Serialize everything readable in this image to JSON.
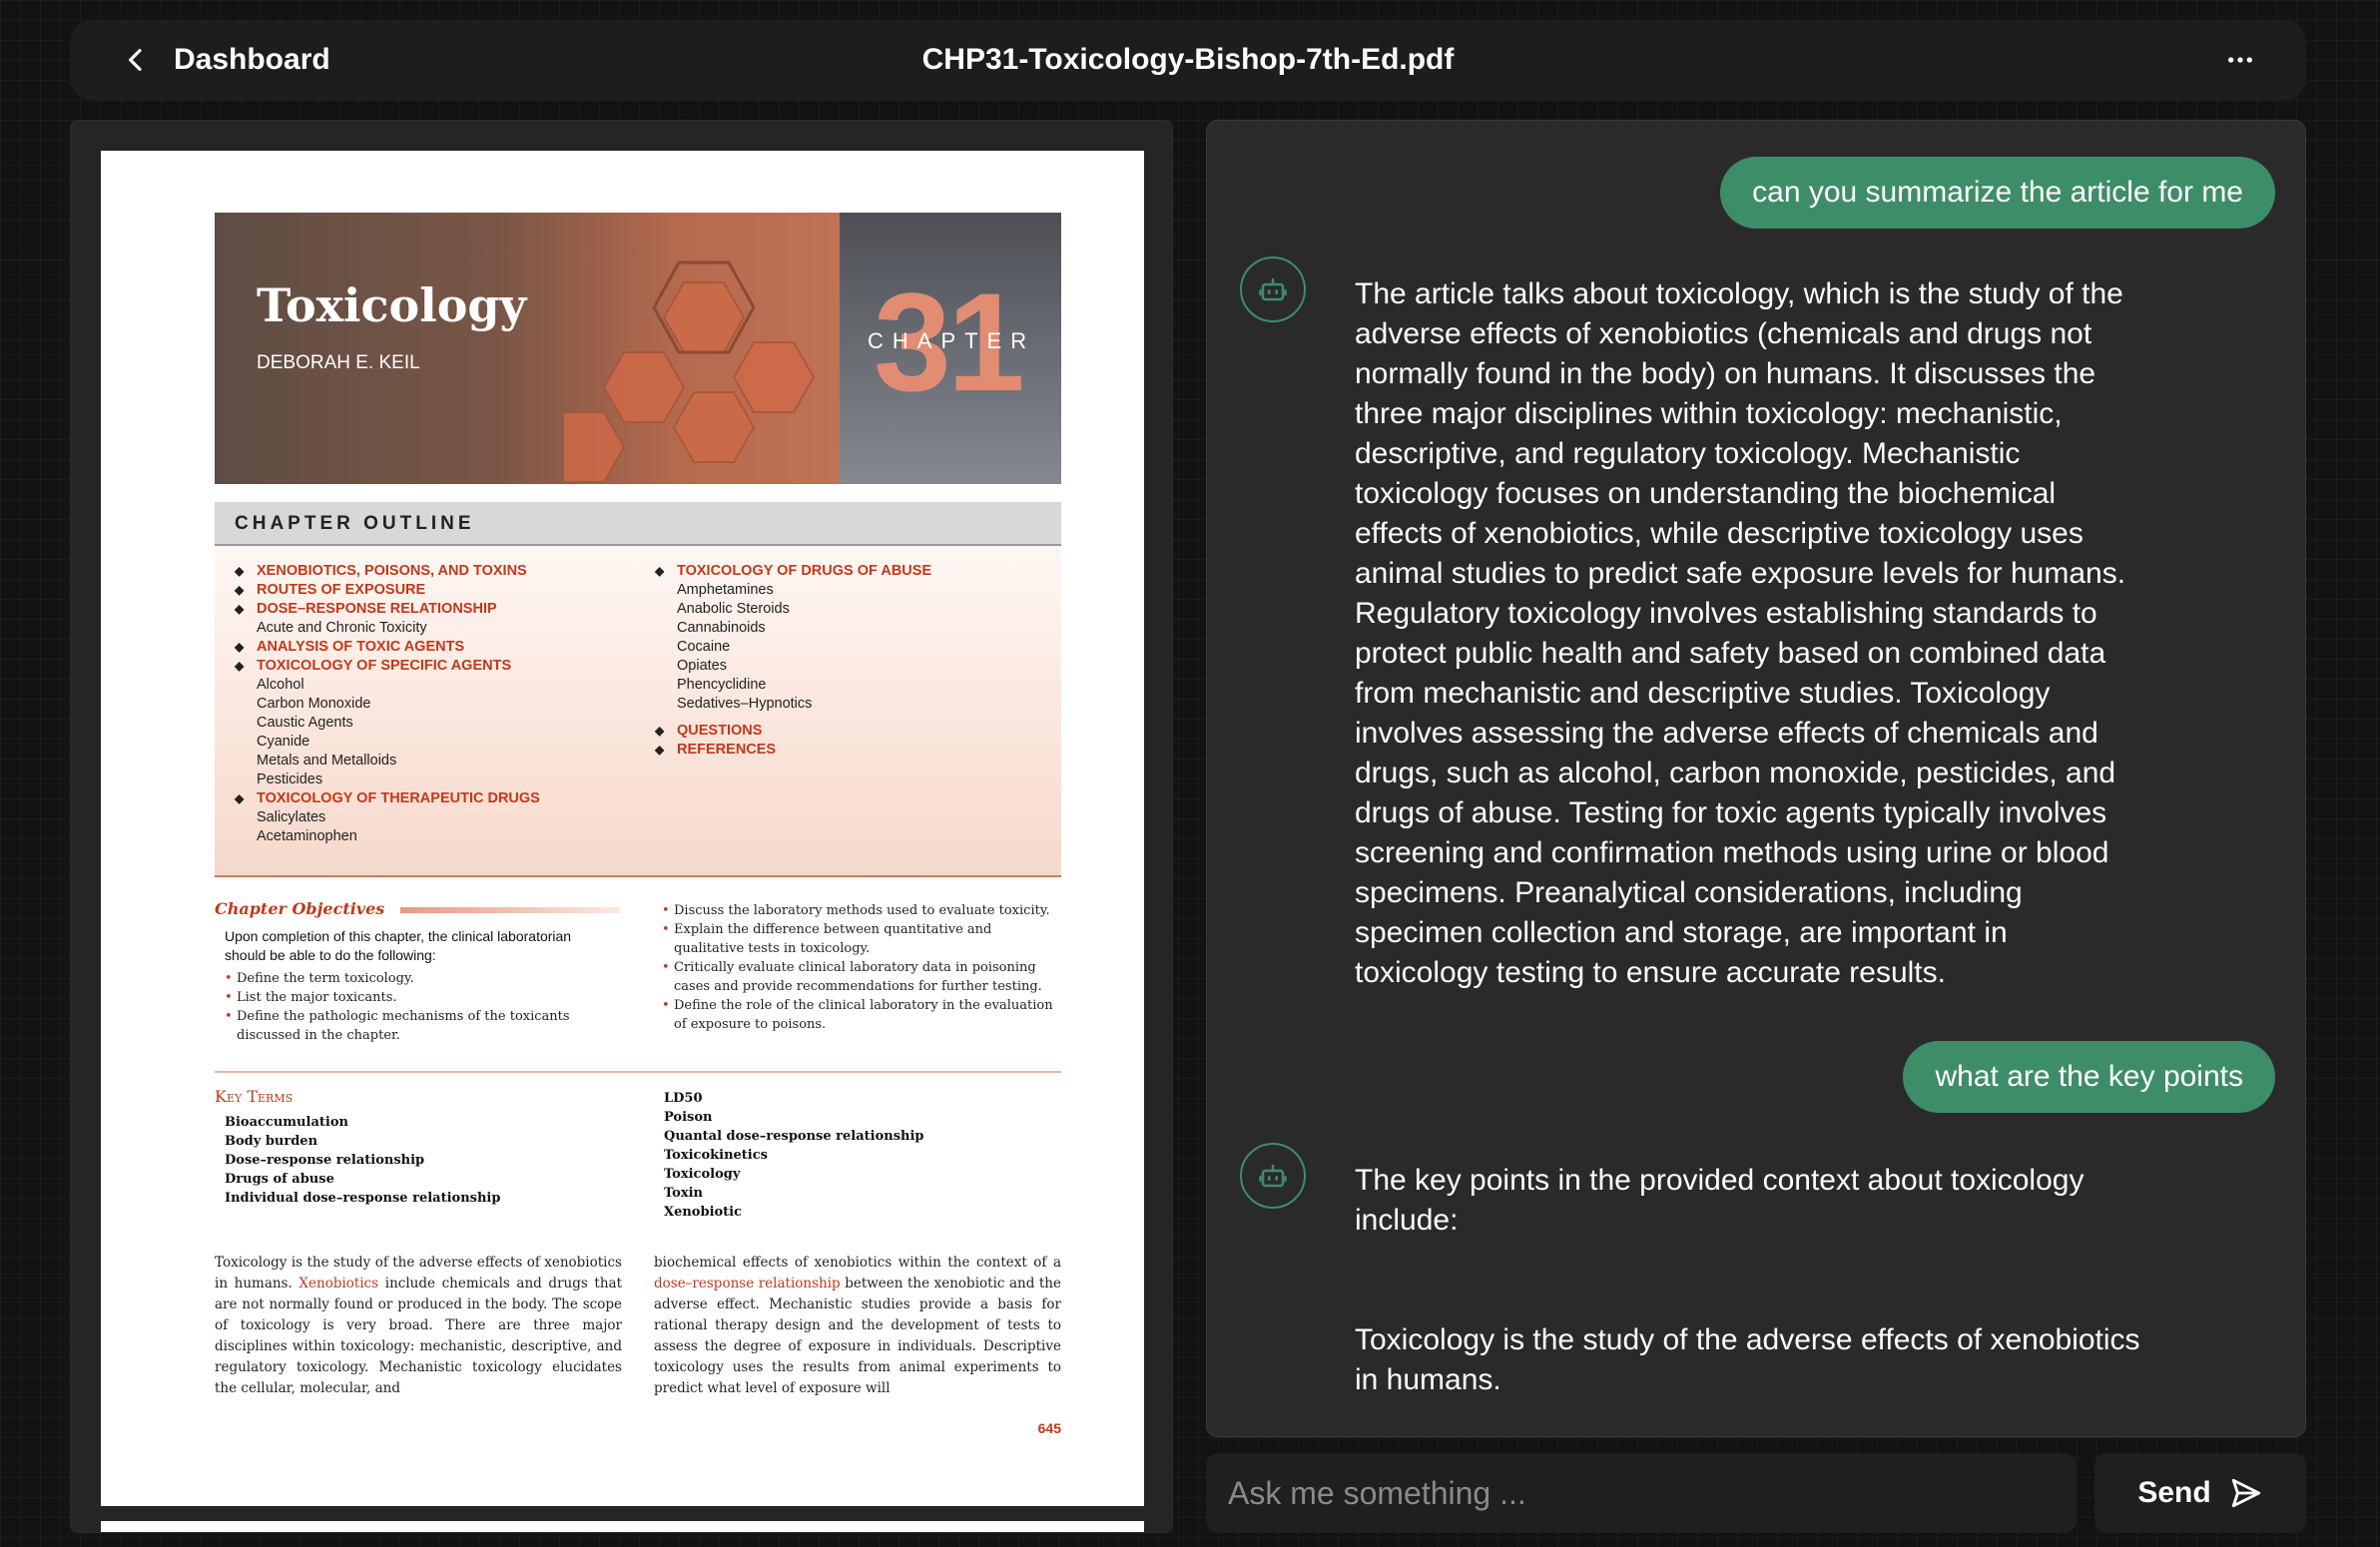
{
  "header": {
    "back_label": "Dashboard",
    "title": "CHP31-Toxicology-Bishop-7th-Ed.pdf",
    "back_icon": "chevron-left-icon",
    "more_icon": "more-horizontal-icon"
  },
  "pdf": {
    "chapter_title": "Toxicology",
    "author": "DEBORAH E. KEIL",
    "chapter_word": "CHAPTER",
    "chapter_number": "31",
    "outline_heading": "CHAPTER OUTLINE",
    "outline_col1": [
      {
        "type": "sec",
        "text": "XENOBIOTICS, POISONS, AND TOXINS"
      },
      {
        "type": "sec",
        "text": "ROUTES OF EXPOSURE"
      },
      {
        "type": "sec",
        "text": "DOSE–RESPONSE RELATIONSHIP"
      },
      {
        "type": "sub",
        "text": "Acute and Chronic Toxicity"
      },
      {
        "type": "sec",
        "text": "ANALYSIS OF TOXIC AGENTS"
      },
      {
        "type": "sec",
        "text": "TOXICOLOGY OF SPECIFIC AGENTS"
      },
      {
        "type": "sub",
        "text": "Alcohol"
      },
      {
        "type": "sub",
        "text": "Carbon Monoxide"
      },
      {
        "type": "sub",
        "text": "Caustic Agents"
      },
      {
        "type": "sub",
        "text": "Cyanide"
      },
      {
        "type": "sub",
        "text": "Metals and Metalloids"
      },
      {
        "type": "sub",
        "text": "Pesticides"
      },
      {
        "type": "sec",
        "text": "TOXICOLOGY OF THERAPEUTIC DRUGS"
      },
      {
        "type": "sub",
        "text": "Salicylates"
      },
      {
        "type": "sub",
        "text": "Acetaminophen"
      }
    ],
    "outline_col2": [
      {
        "type": "sec",
        "text": "TOXICOLOGY OF DRUGS OF ABUSE"
      },
      {
        "type": "sub",
        "text": "Amphetamines"
      },
      {
        "type": "sub",
        "text": "Anabolic Steroids"
      },
      {
        "type": "sub",
        "text": "Cannabinoids"
      },
      {
        "type": "sub",
        "text": "Cocaine"
      },
      {
        "type": "sub",
        "text": "Opiates"
      },
      {
        "type": "sub",
        "text": "Phencyclidine"
      },
      {
        "type": "sub",
        "text": "Sedatives–Hypnotics"
      },
      {
        "type": "gap",
        "text": ""
      },
      {
        "type": "sec",
        "text": "QUESTIONS"
      },
      {
        "type": "sec",
        "text": "REFERENCES"
      }
    ],
    "objectives_title": "Chapter Objectives",
    "objectives_intro": "Upon completion of this chapter, the clinical laboratorian should be able to do the following:",
    "objectives_col1": [
      "Define the term toxicology.",
      "List the major toxicants.",
      "Define the pathologic mechanisms of the toxicants discussed in the chapter."
    ],
    "objectives_col2": [
      "Discuss the laboratory methods used to evaluate toxicity.",
      "Explain the difference between quantitative and qualitative tests in toxicology.",
      "Critically evaluate clinical laboratory data in poisoning cases and provide recommendations for further testing.",
      "Define the role of the clinical laboratory in the evaluation of exposure to poisons."
    ],
    "key_terms_title": "Key Terms",
    "key_terms_col1": [
      "Bioaccumulation",
      "Body burden",
      "Dose–response relationship",
      "Drugs of abuse",
      "Individual dose–response relationship"
    ],
    "key_terms_col2": [
      "LD50",
      "Poison",
      "Quantal dose–response relationship",
      "Toxicokinetics",
      "Toxicology",
      "Toxin",
      "Xenobiotic"
    ],
    "body_col1_a": "Toxicology is the study of the adverse effects of xenobiotics in humans. ",
    "body_col1_link": "Xenobiotics",
    "body_col1_b": " include chemicals and drugs that are not normally found or produced in the body. The scope of toxicology is very broad. There are three major disciplines within toxicology: mechanistic, descriptive, and regulatory toxicology. Mechanistic toxicology elucidates the cellular, molecular, and",
    "body_col2_a": "biochemical effects of xenobiotics within the context of a ",
    "body_col2_link": "dose–response relationship",
    "body_col2_b": " between the xenobiotic and the adverse effect. Mechanistic studies provide a basis for rational therapy design and the development of tests to assess the degree of exposure in individuals. Descriptive toxicology uses the results from animal experiments to predict what level of exposure will",
    "page_number": "645"
  },
  "chat": {
    "messages": [
      {
        "role": "user",
        "text": "can you summarize the article for me"
      },
      {
        "role": "bot",
        "text": "The article talks about toxicology, which is the study of the adverse effects of xenobiotics (chemicals and drugs not normally found in the body) on humans. It discusses the three major disciplines within toxicology: mechanistic, descriptive, and regulatory toxicology. Mechanistic toxicology focuses on understanding the biochemical effects of xenobiotics, while descriptive toxicology uses animal studies to predict safe exposure levels for humans. Regulatory toxicology involves establishing standards to protect public health and safety based on combined data from mechanistic and descriptive studies. Toxicology involves assessing the adverse effects of chemicals and drugs, such as alcohol, carbon monoxide, pesticides, and drugs of abuse. Testing for toxic agents typically involves screening and confirmation methods using urine or blood specimens. Preanalytical considerations, including specimen collection and storage, are important in toxicology testing to ensure accurate results."
      },
      {
        "role": "user",
        "text": "what are the key points"
      },
      {
        "role": "bot",
        "text": "The key points in the provided context about toxicology include:"
      },
      {
        "role": "bot-cont",
        "text": "Toxicology is the study of the adverse effects of xenobiotics in humans."
      }
    ],
    "bot_icon": "robot-icon",
    "input_placeholder": "Ask me something ...",
    "send_label": "Send",
    "send_icon": "send-icon"
  },
  "colors": {
    "accent_green": "#3e8d69",
    "pdf_accent_red": "#c0391b"
  }
}
